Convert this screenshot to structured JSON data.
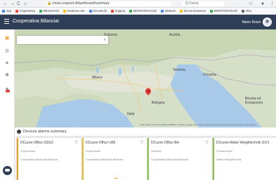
{
  "browser": {
    "back": "←",
    "forward": "→",
    "reload": "C",
    "url": "cloud.coopnet.it/dashboard/summary",
    "extension_search": "Q  Cerca",
    "bookmarks": [
      {
        "label": "App",
        "color": "#4285f4"
      },
      {
        "label": "Cooperativa",
        "color": "#ea4335"
      },
      {
        "label": "MESSAGGI",
        "color": "#34a853"
      },
      {
        "label": "Gestione rete",
        "color": "#fbbc05"
      },
      {
        "label": "Documenti",
        "color": "#4285f4"
      },
      {
        "label": "Support",
        "color": "#ea4335"
      },
      {
        "label": "MONITORAGGIO",
        "color": "#34a853"
      },
      {
        "label": "Network",
        "color": "#4285f4"
      },
      {
        "label": "Sincronizzazione",
        "color": "#fbbc05"
      },
      {
        "label": "MONITORAGGIO",
        "color": "#34a853"
      },
      {
        "label": "Altro",
        "color": "#5f6368"
      }
    ]
  },
  "header": {
    "title": "Cooperativa Bilanciai",
    "user_name": "Mario Rossi"
  },
  "map": {
    "labels": {
      "alpine_region": "Svizzera",
      "croatia": "Croazia",
      "bologna": "Bologna",
      "bosnia": "Bosnia ed Erzegovina",
      "milan": "Milano",
      "venice": "Venezia",
      "austria": "Austria",
      "italia": "Italia"
    },
    "footer": "Dati mappa ©2021 GeoBasis-DE/BKG (©2009), Google, Inst. Geogr. Nacional  Termini d'uso  Segnala un errore nella mappa",
    "marker_color": "#e53935"
  },
  "summary": {
    "title": "Devices alarms summary"
  },
  "cards": [
    {
      "name": "DCuore-Office S5S/2",
      "type": "Supervisore",
      "org": "Cooperativa Bilanciai Modena",
      "alarm": "-",
      "stripe": "#f0a020"
    },
    {
      "name": "DCuore-Office U86",
      "type": "Supervisore",
      "org": "Cooperativa Bilanciai Modena",
      "alarm": "-",
      "stripe": "#f0c020"
    },
    {
      "name": "DCuore-Office BA",
      "type": "Sistema",
      "org": "Cooperativa Bilanciai Modena",
      "alarm": "-",
      "stripe": "#8bc34a"
    },
    {
      "name": "DCuore-Water Weightechnik SV/1",
      "type": "Plurifunzione",
      "org": "Water Weightechnik",
      "alarm": "-",
      "stripe": "#8bc34a"
    }
  ]
}
